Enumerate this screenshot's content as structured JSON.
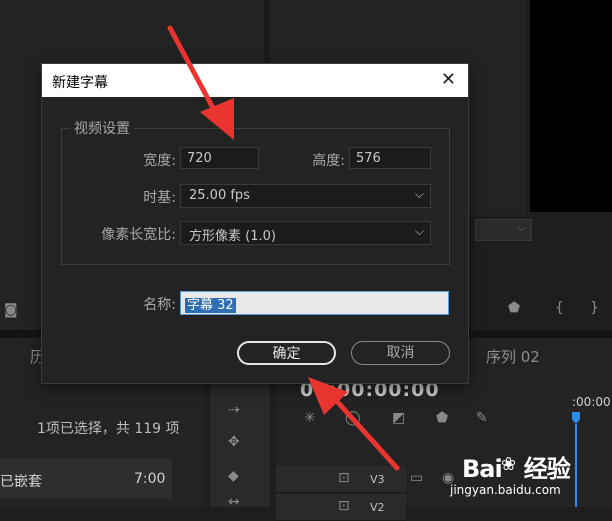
{
  "background": {
    "tabs": {
      "left_partial": "历",
      "sequence": "序列 02"
    },
    "timecode": "00:00:00:00",
    "timecode_small": ":00:00",
    "selection_info": "1项已选择，共 119 项",
    "list_item": {
      "name": "已嵌套",
      "duration": "7:00"
    },
    "tracks": [
      "V3",
      "V2"
    ]
  },
  "dialog": {
    "title": "新建字幕",
    "group_title": "视频设置",
    "width_label": "宽度:",
    "width_value": "720",
    "height_label": "高度:",
    "height_value": "576",
    "timebase_label": "时基:",
    "timebase_value": "25.00 fps",
    "par_label": "像素长宽比:",
    "par_value": "方形像素 (1.0)",
    "name_label": "名称:",
    "name_value": "字幕 32",
    "ok_label": "确定",
    "cancel_label": "取消"
  },
  "watermark": {
    "brand": "Bai",
    "brand_tail": "经验",
    "site": "jingyan.baidu.com"
  },
  "colors": {
    "accent_blue": "#2d8ceb",
    "arrow_red": "#e8352f",
    "selection_blue": "#2f6db5"
  }
}
